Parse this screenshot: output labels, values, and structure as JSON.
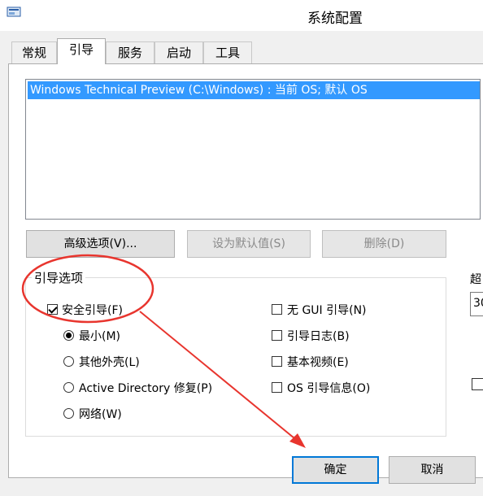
{
  "window": {
    "title": "系统配置",
    "app_icon": "msconfig-icon"
  },
  "tabs": [
    {
      "label": "常规",
      "active": false
    },
    {
      "label": "引导",
      "active": true
    },
    {
      "label": "服务",
      "active": false
    },
    {
      "label": "启动",
      "active": false
    },
    {
      "label": "工具",
      "active": false
    }
  ],
  "boot_list": {
    "items": [
      "Windows Technical Preview (C:\\Windows) : 当前 OS; 默认 OS"
    ],
    "selected": 0
  },
  "buttons": {
    "advanced": "高级选项(V)...",
    "set_default": "设为默认值(S)",
    "delete": "删除(D)"
  },
  "boot_options": {
    "title": "引导选项",
    "safe_boot": {
      "label": "安全引导(F)",
      "checked": true
    },
    "radios": [
      {
        "label": "最小(M)",
        "checked": true
      },
      {
        "label": "其他外壳(L)",
        "checked": false
      },
      {
        "label": "Active Directory 修复(P)",
        "checked": false
      },
      {
        "label": "网络(W)",
        "checked": false
      }
    ],
    "right_checks": [
      {
        "label": "无 GUI 引导(N)",
        "checked": false
      },
      {
        "label": "引导日志(B)",
        "checked": false
      },
      {
        "label": "基本视频(E)",
        "checked": false
      },
      {
        "label": "OS 引导信息(O)",
        "checked": false
      }
    ]
  },
  "timeout": {
    "label_partial": "超",
    "value_partial": "30"
  },
  "footer": {
    "ok": "确定",
    "cancel": "取消"
  },
  "annotation": {
    "color": "#e8352e"
  }
}
